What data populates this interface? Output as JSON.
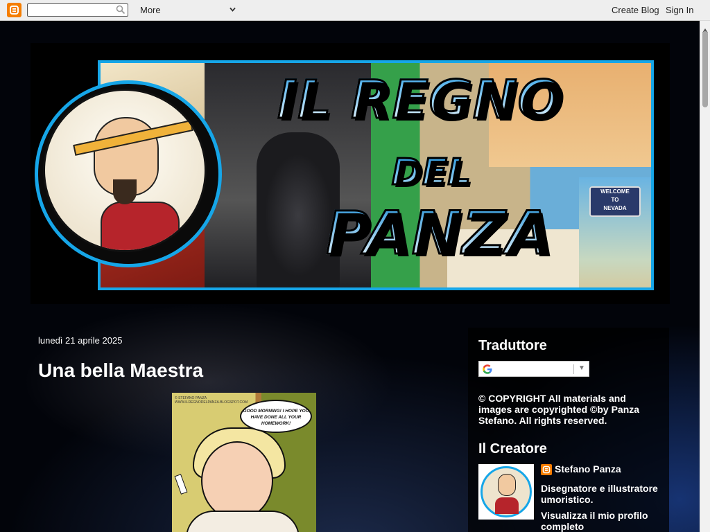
{
  "navbar": {
    "search_placeholder": "",
    "more_label": "More",
    "create_blog_label": "Create Blog",
    "sign_in_label": "Sign In"
  },
  "banner": {
    "title_line1": "IL REGNO",
    "title_line2": "DEL",
    "title_line3": "PANZA",
    "sign_line1": "WELCOME",
    "sign_line2": "TO",
    "sign_line3": "NEVADA"
  },
  "post": {
    "date": "lunedì 21 aprile 2025",
    "title": "Una bella Maestra",
    "image_bubble": "GOOD MORNING! I HOPE YOU HAVE DONE ALL YOUR HOMEWORK!",
    "image_credit": "© STEFANO PANZA WWW.ILREGNODELPANZA.BLOGSPOT.COM"
  },
  "sidebar": {
    "translator_title": "Traduttore",
    "copyright_text": "© COPYRIGHT All materials and images are copyrighted ©by Panza Stefano. All rights reserved.",
    "creator_title": "Il Creatore",
    "author_name": "Stefano Panza",
    "author_description": "Disegnatore e illustratore umoristico.",
    "profile_link": "Visualizza il mio profilo completo"
  },
  "colors": {
    "accent_blue": "#16a6e8",
    "blogger_orange": "#f57d00",
    "background": "#000000"
  }
}
